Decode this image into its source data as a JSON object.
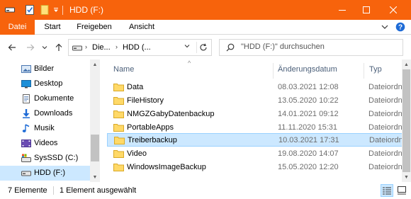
{
  "window": {
    "title": "HDD (F:)",
    "accent_color": "#f7630c",
    "quick_access_icons": [
      "drive-icon",
      "properties-checkmark-icon",
      "new-folder-icon",
      "customize-dropdown-icon"
    ],
    "controls": [
      "minimize-icon",
      "maximize-icon",
      "close-icon"
    ]
  },
  "ribbon": {
    "tabs": [
      {
        "label": "Datei",
        "active": true
      },
      {
        "label": "Start",
        "active": false
      },
      {
        "label": "Freigeben",
        "active": false
      },
      {
        "label": "Ansicht",
        "active": false
      }
    ]
  },
  "address": {
    "segments": [
      "Die...",
      "HDD (..."
    ],
    "search_placeholder": "\"HDD (F:)\" durchsuchen"
  },
  "nav_pane": {
    "items": [
      {
        "label": "Bilder",
        "icon": "pictures-icon",
        "selected": false
      },
      {
        "label": "Desktop",
        "icon": "desktop-icon",
        "selected": false
      },
      {
        "label": "Dokumente",
        "icon": "documents-icon",
        "selected": false
      },
      {
        "label": "Downloads",
        "icon": "downloads-icon",
        "selected": false
      },
      {
        "label": "Musik",
        "icon": "music-icon",
        "selected": false
      },
      {
        "label": "Videos",
        "icon": "videos-icon",
        "selected": false
      },
      {
        "label": "SysSSD (C:)",
        "icon": "system-drive-icon",
        "selected": false
      },
      {
        "label": "HDD (F:)",
        "icon": "drive-icon",
        "selected": true
      }
    ]
  },
  "file_list": {
    "columns": [
      "Name",
      "Änderungsdatum",
      "Typ"
    ],
    "sorted_by": "Name",
    "rows": [
      {
        "name": "Data",
        "date": "08.03.2021 12:08",
        "type": "Dateiordner",
        "selected": false
      },
      {
        "name": "FileHistory",
        "date": "13.05.2020 10:22",
        "type": "Dateiordner",
        "selected": false
      },
      {
        "name": "NMGZGabyDatenbackup",
        "date": "14.01.2021 09:12",
        "type": "Dateiordner",
        "selected": false
      },
      {
        "name": "PortableApps",
        "date": "11.11.2020 15:31",
        "type": "Dateiordner",
        "selected": false
      },
      {
        "name": "Treiberbackup",
        "date": "10.03.2021 17:31",
        "type": "Dateiordner",
        "selected": true
      },
      {
        "name": "Video",
        "date": "19.08.2020 14:07",
        "type": "Dateiordner",
        "selected": false
      },
      {
        "name": "WindowsImageBackup",
        "date": "15.05.2020 12:20",
        "type": "Dateiordner",
        "selected": false
      }
    ]
  },
  "status": {
    "item_count": "7 Elemente",
    "selection": "1 Element ausgewählt",
    "active_view": "details"
  }
}
